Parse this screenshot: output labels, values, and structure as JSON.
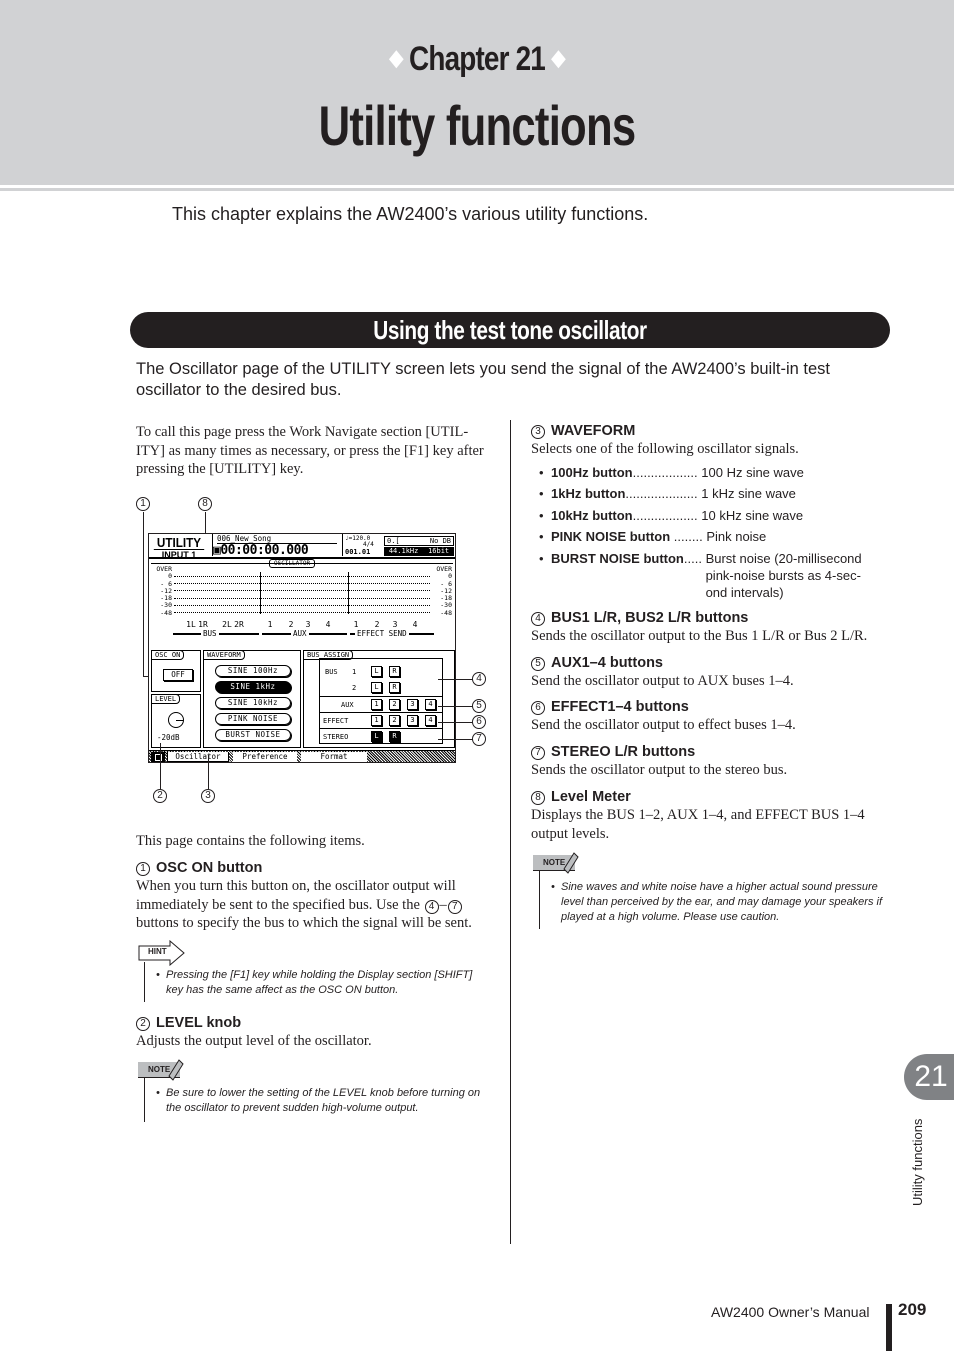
{
  "header": {
    "chapter_label": "Chapter 21",
    "chapter_title": "Utility functions",
    "intro": "This chapter explains the AW2400’s various utility functions."
  },
  "section": {
    "title": "Using the test tone oscillator",
    "intro": "The Oscillator page of the UTILITY screen lets you send the signal of the AW2400’s built-in test oscillator to the desired bus."
  },
  "left_column": {
    "call_instructions": "To call this page press the Work Navigate section [UTIL-ITY] as many times as necessary, or press the [F1] key after pressing the [UTILITY] key.",
    "items_intro": "This page contains the following items.",
    "item1": {
      "num": "1",
      "title": "OSC ON button",
      "body_a": "When you turn this button on, the oscillator output will immediately be sent to the specified bus. Use the ",
      "ref_from": "4",
      "dash": "–",
      "ref_to": "7",
      "body_b": " buttons to specify the bus to which the signal will be sent."
    },
    "hint": {
      "tag": "HINT",
      "text": "Pressing the [F1] key while holding the Display section [SHIFT] key has the same affect as the OSC ON button."
    },
    "item2": {
      "num": "2",
      "title": "LEVEL knob",
      "body": "Adjusts the output level of the oscillator."
    },
    "note": {
      "tag": "NOTE",
      "text": "Be sure to lower the setting of the LEVEL knob before turning on the oscillator to prevent sudden high-volume output."
    }
  },
  "right_column": {
    "item3": {
      "num": "3",
      "title": "WAVEFORM",
      "body": "Selects one of the following oscillator signals.",
      "options": [
        {
          "term": "100Hz button",
          "dots": "..................",
          "desc": "100 Hz sine wave"
        },
        {
          "term": "1kHz button",
          "dots": "....................",
          "desc": "1 kHz sine wave"
        },
        {
          "term": "10kHz button",
          "dots": "..................",
          "desc": "10 kHz sine wave"
        },
        {
          "term": "PINK NOISE button",
          "dots": " ........",
          "desc": "Pink noise"
        },
        {
          "term": "BURST NOISE button",
          "dots": ".....",
          "desc": "Burst noise (20-millisecond pink-noise bursts as 4-sec-ond intervals)"
        }
      ]
    },
    "item4": {
      "num": "4",
      "title": "BUS1 L/R, BUS2 L/R buttons",
      "body": "Sends the oscillator output to the Bus 1 L/R or Bus 2 L/R."
    },
    "item5": {
      "num": "5",
      "title": "AUX1–4 buttons",
      "body": "Send the oscillator output to AUX buses 1–4."
    },
    "item6": {
      "num": "6",
      "title": "EFFECT1–4 buttons",
      "body": "Send the oscillator output to effect buses 1–4."
    },
    "item7": {
      "num": "7",
      "title": "STEREO L/R buttons",
      "body": "Sends the oscillator output to the stereo bus."
    },
    "item8": {
      "num": "8",
      "title": "Level Meter",
      "body": "Displays the BUS 1–2, AUX 1–4, and EFFECT BUS 1–4 output levels."
    },
    "note": {
      "tag": "NOTE",
      "text": "Sine waves and white noise have a higher actual sound pressure level than perceived by the ear, and may damage your speakers if played at a high volume. Please use caution."
    }
  },
  "lcd": {
    "screen_name": "UTILITY",
    "input": "INPUT 1",
    "song": "006_New_Song",
    "lock_icon": "lock-icon",
    "time": "00:00:00.000",
    "tempo": "♩=120.0",
    "meter": "4/4",
    "bar_beat": "001.01",
    "box_left": "0.[",
    "box_right": "No DB",
    "sample_rate": "44.1kHz",
    "bit_depth": "16bit",
    "meter_title": "OSCILLATOR",
    "meter_scale": [
      "OVER",
      "0",
      "- 6",
      "-12",
      "-18",
      "-30",
      "-48"
    ],
    "meter_channels": [
      "1L",
      "1R",
      "2L",
      "2R",
      "1",
      "2",
      "3",
      "4",
      "1",
      "2",
      "3",
      "4"
    ],
    "meter_groups": [
      "BUS",
      "AUX",
      "EFFECT SEND"
    ],
    "osc_on_title": "OSC ON",
    "osc_on_value": "OFF",
    "level_title": "LEVEL",
    "level_value": "-20dB",
    "waveform_title": "WAVEFORM",
    "waveforms": [
      "SINE 100Hz",
      "SINE  1kHz",
      "SINE 10kHz",
      "PINK NOISE",
      "BURST NOISE"
    ],
    "selected_waveform": "SINE  1kHz",
    "bus_assign_title": "BUS ASSIGN",
    "bus_label": "BUS",
    "bus1": "1",
    "bus2": "2",
    "aux_label": "AUX",
    "effect_label": "EFFECT",
    "stereo_label": "STEREO",
    "L": "L",
    "R": "R",
    "nums": [
      "1",
      "2",
      "3",
      "4"
    ],
    "tabs": [
      "Oscillator",
      "Preference",
      "Format"
    ],
    "active_tab": "Oscillator"
  },
  "callouts": [
    "1",
    "2",
    "3",
    "4",
    "5",
    "6",
    "7",
    "8"
  ],
  "side_tab": {
    "number": "21",
    "label": "Utility functions"
  },
  "footer": {
    "manual": "AW2400  Owner’s Manual",
    "page": "209"
  }
}
